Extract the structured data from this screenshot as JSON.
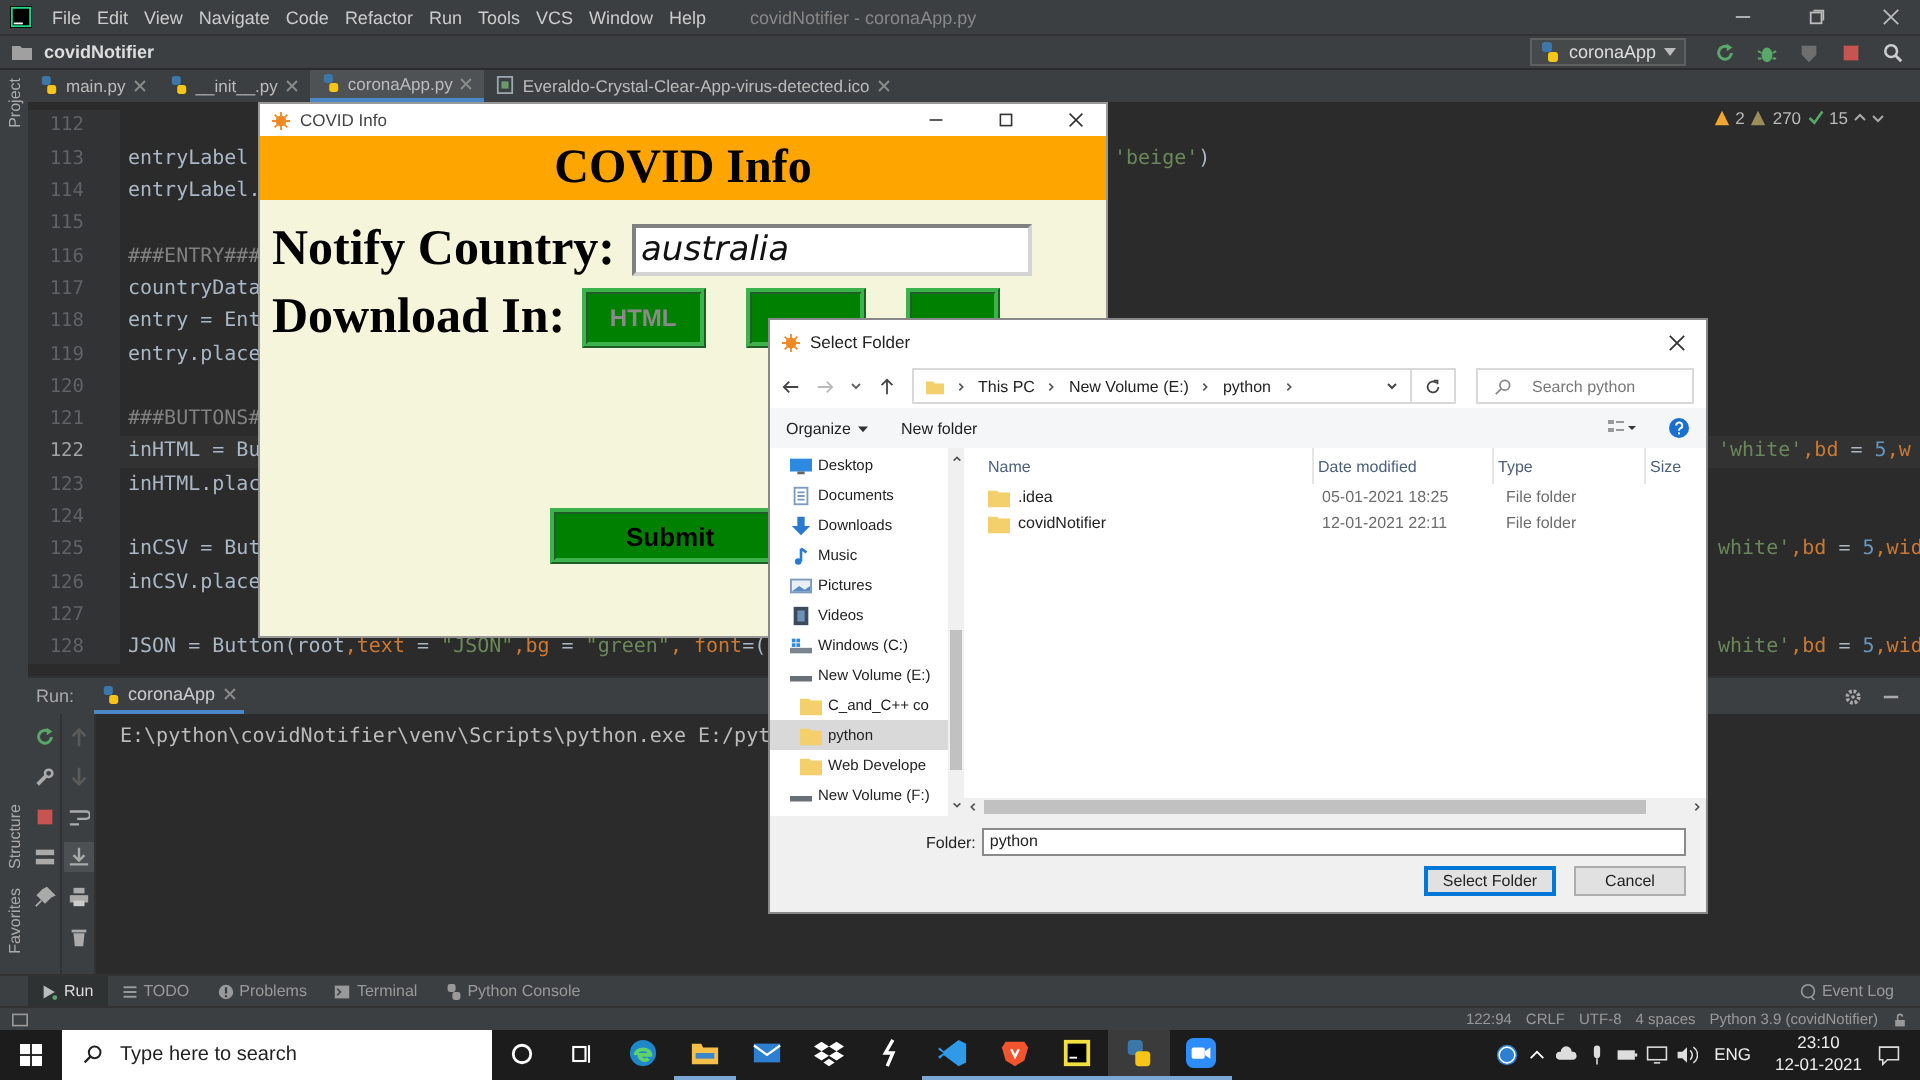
{
  "ide": {
    "menu": [
      "File",
      "Edit",
      "View",
      "Navigate",
      "Code",
      "Refactor",
      "Run",
      "Tools",
      "VCS",
      "Window",
      "Help"
    ],
    "title": "covidNotifier - coronaApp.py",
    "project": "covidNotifier",
    "run_config": "coronaApp",
    "top_side_label": "Project",
    "tabs": [
      {
        "label": "main.py",
        "kind": "py",
        "selected": false
      },
      {
        "label": "__init__.py",
        "kind": "py",
        "selected": false
      },
      {
        "label": "coronaApp.py",
        "kind": "py",
        "selected": true
      },
      {
        "label": "Everaldo-Crystal-Clear-App-virus-detected.ico",
        "kind": "ico",
        "selected": false
      }
    ],
    "inspections": {
      "warnings": "2",
      "weak_warnings": "270",
      "typos": "15"
    },
    "code_lines": [
      {
        "number": "112",
        "current": false
      },
      {
        "number": "113",
        "current": false,
        "code": [
          {
            "text": "entryLabel",
            "kind": "plain"
          }
        ],
        "mid": [
          {
            "text": "'beige'",
            "kind": "string"
          },
          {
            "text": ")",
            "kind": "plain"
          }
        ]
      },
      {
        "number": "114",
        "current": false,
        "code": [
          {
            "text": "entryLabel.",
            "kind": "plain"
          }
        ]
      },
      {
        "number": "115",
        "current": false
      },
      {
        "number": "116",
        "current": false,
        "code": [
          {
            "text": "###ENTRY###",
            "kind": "comment"
          }
        ]
      },
      {
        "number": "117",
        "current": false,
        "code": [
          {
            "text": "countryData",
            "kind": "plain"
          }
        ]
      },
      {
        "number": "118",
        "current": false,
        "code": [
          {
            "text": "entry = Ent",
            "kind": "plain"
          }
        ]
      },
      {
        "number": "119",
        "current": false,
        "code": [
          {
            "text": "entry.place",
            "kind": "plain"
          }
        ]
      },
      {
        "number": "120",
        "current": false
      },
      {
        "number": "121",
        "current": false,
        "code": [
          {
            "text": "###BUTTONS#",
            "kind": "comment"
          }
        ]
      },
      {
        "number": "122",
        "current": true,
        "code": [
          {
            "text": "inHTML = Bu",
            "kind": "plain"
          }
        ],
        "far": [
          {
            "text": "'white'",
            "kind": "string"
          },
          {
            "text": ",bd",
            "kind": "keyword"
          },
          {
            "text": " = ",
            "kind": "plain"
          },
          {
            "text": "5",
            "kind": "number"
          },
          {
            "text": ",w",
            "kind": "keyword"
          }
        ]
      },
      {
        "number": "123",
        "current": false,
        "code": [
          {
            "text": "inHTML.plac",
            "kind": "plain"
          }
        ]
      },
      {
        "number": "124",
        "current": false
      },
      {
        "number": "125",
        "current": false,
        "code": [
          {
            "text": "inCSV = But",
            "kind": "plain"
          }
        ],
        "far": [
          {
            "text": "white'",
            "kind": "string"
          },
          {
            "text": ",bd",
            "kind": "keyword"
          },
          {
            "text": " = ",
            "kind": "plain"
          },
          {
            "text": "5",
            "kind": "number"
          },
          {
            "text": ",wid",
            "kind": "keyword"
          }
        ]
      },
      {
        "number": "126",
        "current": false,
        "code": [
          {
            "text": "inCSV.place",
            "kind": "plain"
          }
        ]
      },
      {
        "number": "127",
        "current": false
      },
      {
        "number": "128",
        "current": false,
        "code": [
          {
            "text": "JSON = Button(root",
            "kind": "plain"
          },
          {
            "text": ",text",
            "kind": "keyword"
          },
          {
            "text": " = ",
            "kind": "plain"
          },
          {
            "text": "\"JSON\"",
            "kind": "string"
          },
          {
            "text": ",bg",
            "kind": "keyword"
          },
          {
            "text": " = ",
            "kind": "plain"
          },
          {
            "text": "\"green\"",
            "kind": "string"
          },
          {
            "text": ", font",
            "kind": "keyword"
          },
          {
            "text": "=(",
            "kind": "plain"
          }
        ],
        "far": [
          {
            "text": "white'",
            "kind": "string"
          },
          {
            "text": ",bd",
            "kind": "keyword"
          },
          {
            "text": " = ",
            "kind": "plain"
          },
          {
            "text": "5",
            "kind": "number"
          },
          {
            "text": ",wid",
            "kind": "keyword"
          }
        ]
      }
    ],
    "run_panel": {
      "label": "Run:",
      "tab": "coronaApp",
      "output": "E:\\python\\covidNotifier\\venv\\Scripts\\python.exe E:/pyt"
    },
    "bottom_side_labels": [
      "Structure",
      "Favorites"
    ],
    "tool_tabs": [
      {
        "label": "Run",
        "kind": "run",
        "selected": true
      },
      {
        "label": "TODO",
        "kind": "todo",
        "selected": false
      },
      {
        "label": "Problems",
        "kind": "problems",
        "selected": false
      },
      {
        "label": "Terminal",
        "kind": "terminal",
        "selected": false
      },
      {
        "label": "Python Console",
        "kind": "console",
        "selected": false
      }
    ],
    "event_log": "Event Log",
    "status": [
      "122:94",
      "CRLF",
      "UTF-8",
      "4 spaces",
      "Python 3.9 (covidNotifier)"
    ]
  },
  "covid_window": {
    "title": "COVID Info",
    "header": "COVID Info",
    "country_label": "Notify Country:",
    "country_value": "australia",
    "download_label": "Download In:",
    "format_button": "HTML",
    "submit": "Submit"
  },
  "dialog": {
    "title": "Select Folder",
    "path": [
      "This PC",
      "New Volume (E:)",
      "python"
    ],
    "search_placeholder": "Search python",
    "organize": "Organize",
    "new_folder": "New folder",
    "nav": [
      {
        "label": "Desktop",
        "kind": "desktop",
        "selected": false
      },
      {
        "label": "Documents",
        "kind": "documents",
        "selected": false
      },
      {
        "label": "Downloads",
        "kind": "downloads",
        "selected": false
      },
      {
        "label": "Music",
        "kind": "music",
        "selected": false
      },
      {
        "label": "Pictures",
        "kind": "pictures",
        "selected": false
      },
      {
        "label": "Videos",
        "kind": "videos",
        "selected": false
      },
      {
        "label": "Windows (C:)",
        "kind": "system",
        "selected": false
      },
      {
        "label": "New Volume (E:)",
        "kind": "drive",
        "selected": false,
        "children": [
          {
            "label": "C_and_C++ co",
            "kind": "folder",
            "selected": false
          },
          {
            "label": "python",
            "kind": "folder",
            "selected": true
          },
          {
            "label": "Web Develope",
            "kind": "folder",
            "selected": false
          }
        ]
      },
      {
        "label": "New Volume (F:)",
        "kind": "drive",
        "selected": false
      }
    ],
    "columns": [
      "Name",
      "Date modified",
      "Type",
      "Size"
    ],
    "rows": [
      {
        "name": ".idea",
        "date": "05-01-2021 18:25",
        "type": "File folder"
      },
      {
        "name": "covidNotifier",
        "date": "12-01-2021 22:11",
        "type": "File folder"
      }
    ],
    "folder_label": "Folder:",
    "folder_value": "python",
    "buttons": [
      {
        "label": "Select Folder",
        "kind": "primary"
      },
      {
        "label": "Cancel",
        "kind": "secondary"
      }
    ]
  },
  "taskbar": {
    "search_placeholder": "Type here to search",
    "apps": [
      {
        "kind": "edge",
        "running": false,
        "selected": false
      },
      {
        "kind": "explorer",
        "running": true,
        "selected": false
      },
      {
        "kind": "mail",
        "running": false,
        "selected": false
      },
      {
        "kind": "dropbox",
        "running": false,
        "selected": false
      },
      {
        "kind": "bolt",
        "running": false,
        "selected": false
      },
      {
        "kind": "vscode",
        "running": true,
        "selected": false
      },
      {
        "kind": "brave",
        "running": true,
        "selected": false
      },
      {
        "kind": "pycharm",
        "running": true,
        "selected": false
      },
      {
        "kind": "python",
        "running": true,
        "selected": true
      },
      {
        "kind": "zoom",
        "running": true,
        "selected": false
      }
    ],
    "language": "ENG",
    "time": "23:10",
    "date": "12-01-2021"
  }
}
